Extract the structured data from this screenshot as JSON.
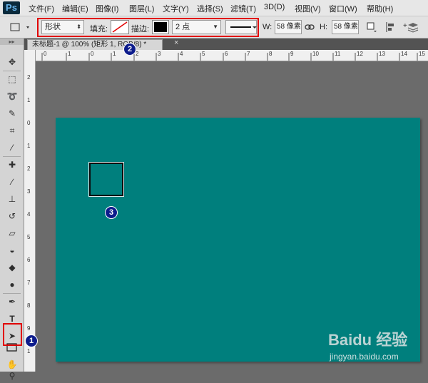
{
  "app": {
    "logo": "Ps"
  },
  "menu": [
    "文件(F)",
    "编辑(E)",
    "图像(I)",
    "图层(L)",
    "文字(Y)",
    "选择(S)",
    "滤镜(T)",
    "3D(D)",
    "视图(V)",
    "窗口(W)",
    "帮助(H)"
  ],
  "options": {
    "tool_mode": "形状",
    "fill_label": "填充:",
    "stroke_label": "描边:",
    "stroke_color": "#000000",
    "stroke_width": "2 点",
    "width_label": "W:",
    "width_value": "58 像素",
    "height_label": "H:",
    "height_value": "58 像素"
  },
  "document": {
    "tab_title": "未标题-1 @ 100% (矩形 1, RGB/8) *",
    "close_glyph": "×"
  },
  "rulers": {
    "top": [
      "0",
      "1",
      "0",
      "1",
      "2",
      "3",
      "4",
      "5",
      "6",
      "7",
      "8",
      "9",
      "10",
      "11",
      "12",
      "13",
      "14",
      "15",
      "16"
    ],
    "left": [
      "2",
      "1",
      "0",
      "1",
      "2",
      "3",
      "4",
      "5",
      "6",
      "7",
      "8",
      "9",
      "1"
    ]
  },
  "canvas": {
    "background": "#007f7d"
  },
  "markers": {
    "m1": "1",
    "m2": "2",
    "m3": "3"
  },
  "tools": [
    "move-tool-icon",
    "marquee-tool-icon",
    "lasso-tool-icon",
    "quick-select-tool-icon",
    "crop-tool-icon",
    "eyedropper-tool-icon",
    "healing-brush-tool-icon",
    "brush-tool-icon",
    "clone-stamp-tool-icon",
    "history-brush-tool-icon",
    "eraser-tool-icon",
    "paint-bucket-tool-icon",
    "blur-tool-icon",
    "dodge-tool-icon",
    "pen-tool-icon",
    "type-tool-icon",
    "path-select-tool-icon",
    "rectangle-tool-icon",
    "hand-tool-icon",
    "zoom-tool-icon"
  ],
  "watermark": {
    "brand": "Baidu 经验",
    "site": "jingyan.baidu.com"
  },
  "colors": {
    "highlight": "#e10000",
    "marker": "#0d1c8c"
  }
}
